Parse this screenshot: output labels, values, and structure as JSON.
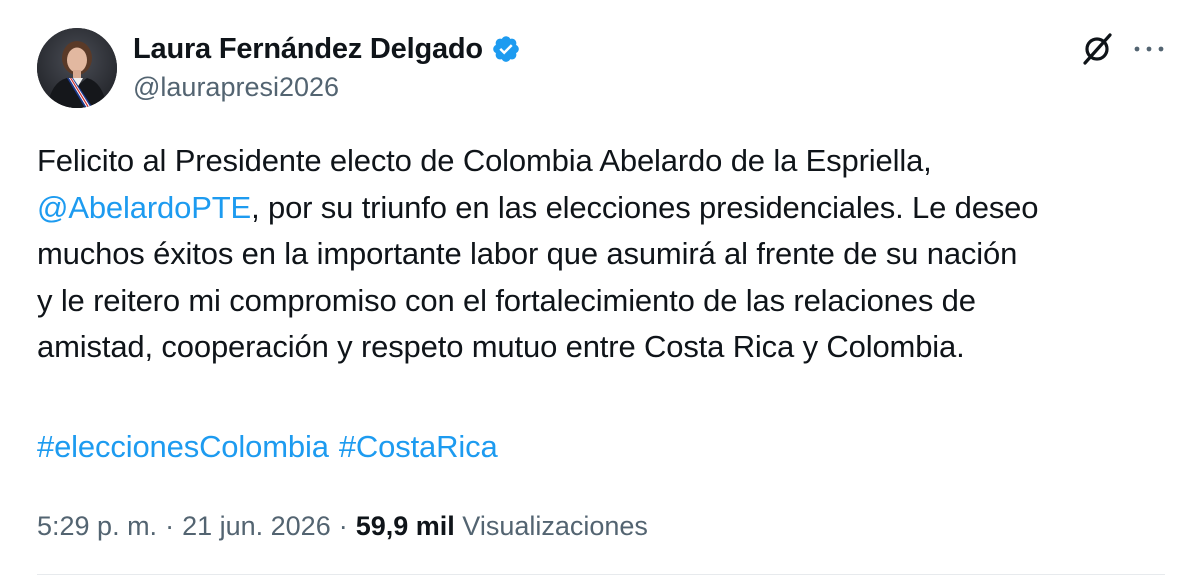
{
  "author": {
    "display_name": "Laura Fernández Delgado",
    "handle": "@laurapresi2026",
    "verified": true,
    "avatar": "profile-photo-avatar"
  },
  "icons": {
    "verified": "verified-badge-icon",
    "grok": "grok-icon",
    "more": "more-options-icon"
  },
  "colors": {
    "link": "#1d9bf0",
    "text": "#0f1419",
    "secondary": "#536471",
    "verified_badge": "#1d9bf0"
  },
  "tweet": {
    "line1": "Felicito al Presidente electo de Colombia Abelardo de la Espriella,",
    "mention": "@AbelardoPTE",
    "line2_rest": ", por su triunfo en las elecciones presidenciales. Le deseo",
    "line3": "muchos éxitos en la importante labor que asumirá al frente de su nación",
    "line4": "y le reitero mi compromiso con el fortalecimiento de las relaciones de",
    "line5": "amistad, cooperación y respeto mutuo entre Costa Rica y Colombia.",
    "hashtags": [
      "#eleccionesColombia",
      "#CostaRica"
    ]
  },
  "meta": {
    "time": "5:29 p. m.",
    "separator": "·",
    "date": "21 jun. 2026",
    "views_count": "59,9 mil",
    "views_label": "Visualizaciones"
  }
}
